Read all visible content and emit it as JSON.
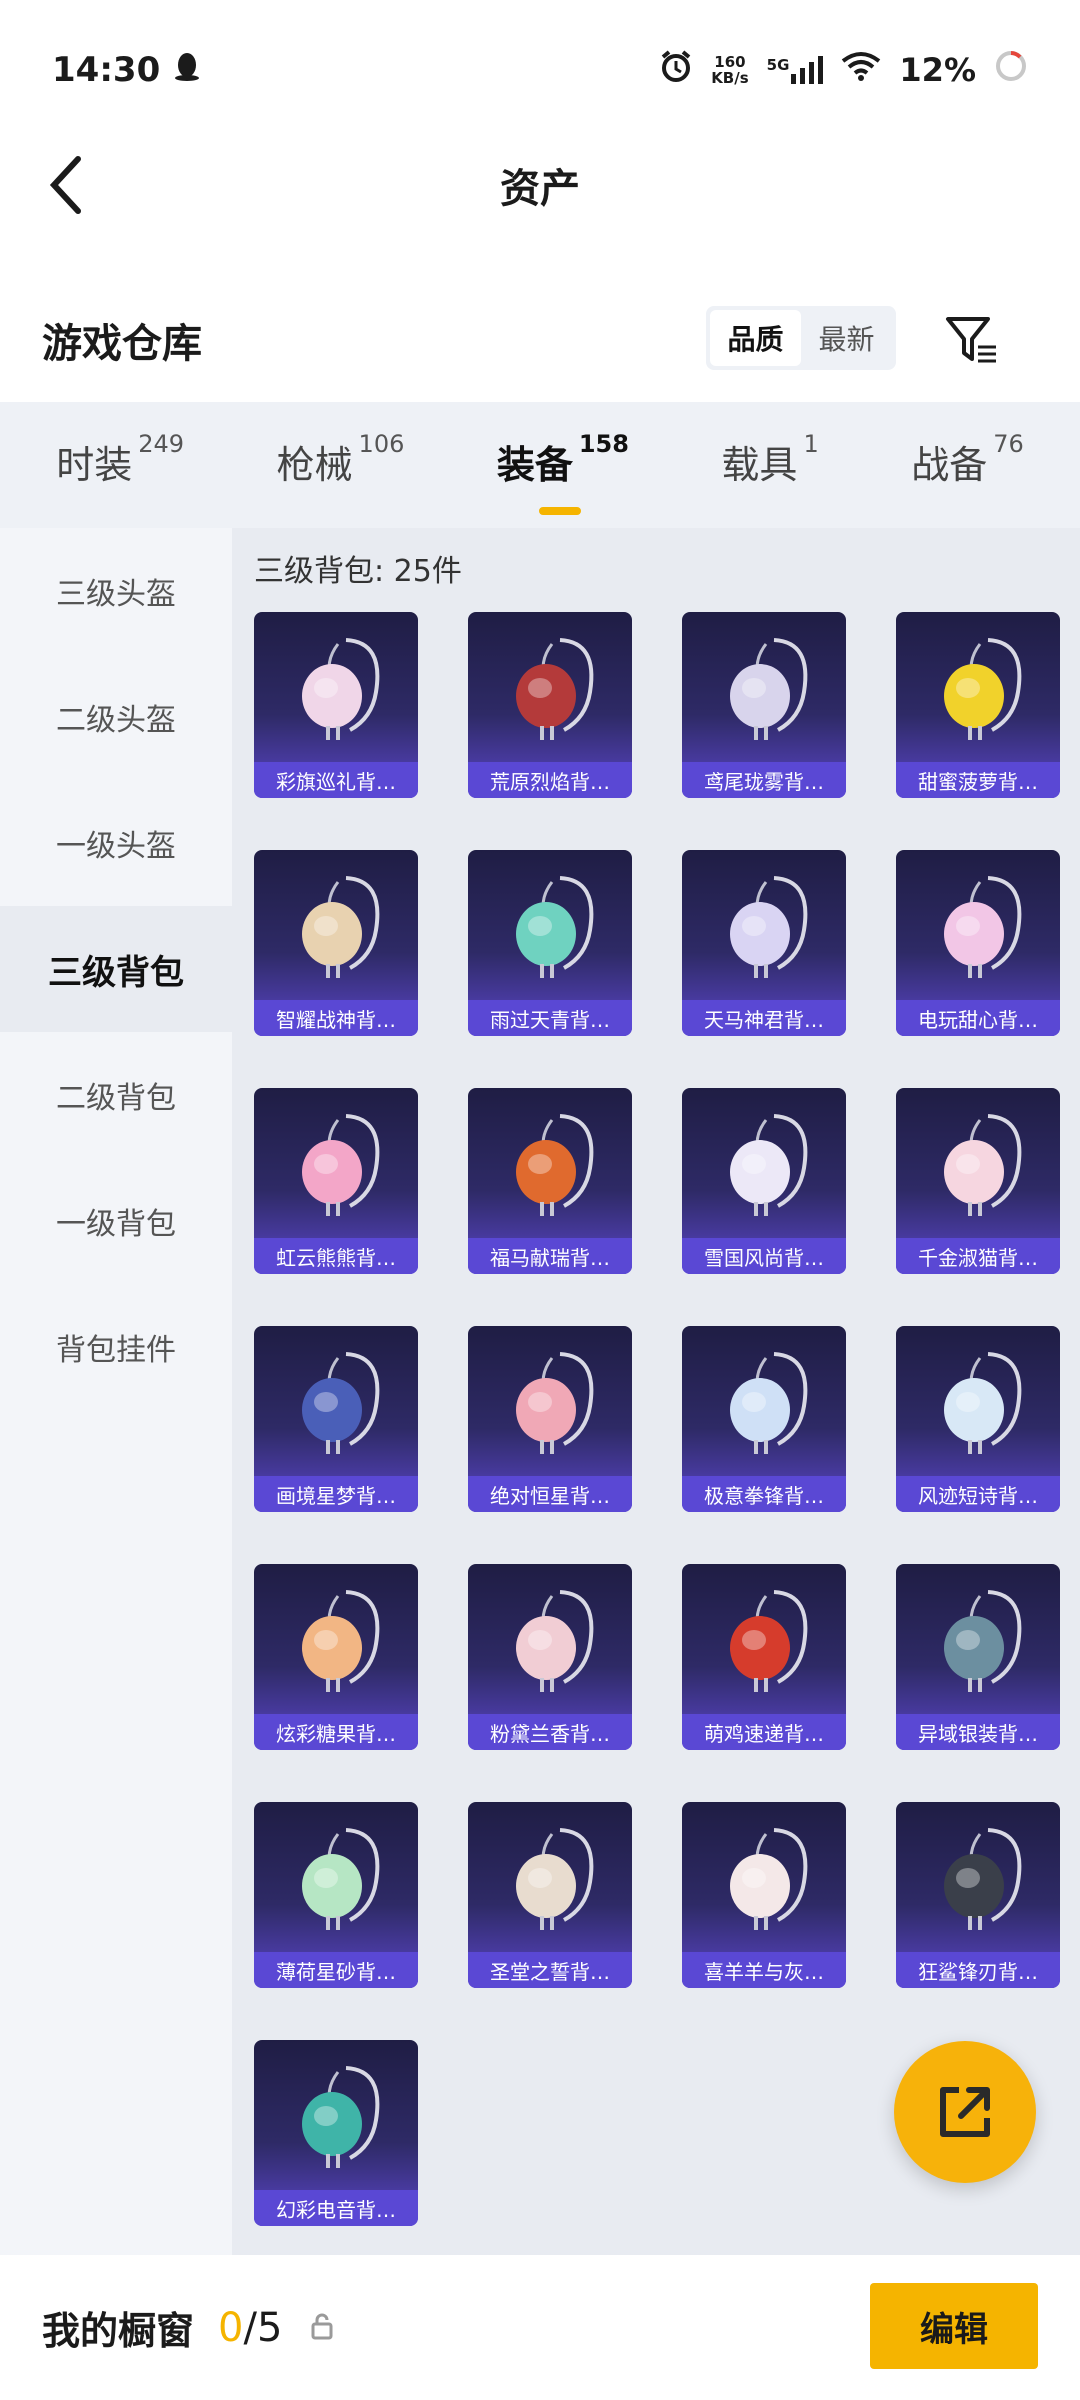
{
  "status_bar": {
    "time": "14:30",
    "net_speed_value": "160",
    "net_speed_unit": "KB/s",
    "network_type": "5G",
    "battery": "12%"
  },
  "header": {
    "title": "资产"
  },
  "warehouse": {
    "title": "游戏仓库",
    "sort_options": [
      "品质",
      "最新"
    ],
    "active_sort": "品质"
  },
  "tabs": [
    {
      "label": "时装",
      "count": "249"
    },
    {
      "label": "枪械",
      "count": "106"
    },
    {
      "label": "装备",
      "count": "158"
    },
    {
      "label": "载具",
      "count": "1"
    },
    {
      "label": "战备",
      "count": "76"
    }
  ],
  "active_tab": "装备",
  "sidebar": {
    "items": [
      "三级头盔",
      "二级头盔",
      "一级头盔",
      "三级背包",
      "二级背包",
      "一级背包",
      "背包挂件"
    ],
    "active": "三级背包"
  },
  "grid": {
    "title": "三级背包: 25件",
    "items": [
      {
        "name": "彩旗巡礼背…",
        "color": "#f0d6e8"
      },
      {
        "name": "荒原烈焰背…",
        "color": "#b43a3a"
      },
      {
        "name": "鸢尾珑雾背…",
        "color": "#d8d4ec"
      },
      {
        "name": "甜蜜菠萝背…",
        "color": "#f1d22b"
      },
      {
        "name": "智耀战神背…",
        "color": "#e8d2b0"
      },
      {
        "name": "雨过天青背…",
        "color": "#6fd2c0"
      },
      {
        "name": "天马神君背…",
        "color": "#d9d4f3"
      },
      {
        "name": "电玩甜心背…",
        "color": "#f2c6e6"
      },
      {
        "name": "虹云熊熊背…",
        "color": "#f3a6c8"
      },
      {
        "name": "福马献瑞背…",
        "color": "#e06a2e"
      },
      {
        "name": "雪国风尚背…",
        "color": "#ece8f7"
      },
      {
        "name": "千金淑猫背…",
        "color": "#f6d6e0"
      },
      {
        "name": "画境星梦背…",
        "color": "#4a5fb8"
      },
      {
        "name": "绝对恒星背…",
        "color": "#f0a8b6"
      },
      {
        "name": "极意拳锋背…",
        "color": "#cfe0f6"
      },
      {
        "name": "风迹短诗背…",
        "color": "#d8e8f6"
      },
      {
        "name": "炫彩糖果背…",
        "color": "#f2b684"
      },
      {
        "name": "粉黛兰香背…",
        "color": "#f1cdd4"
      },
      {
        "name": "萌鸡速递背…",
        "color": "#d63c2c"
      },
      {
        "name": "异域银装背…",
        "color": "#6c8fa0"
      },
      {
        "name": "薄荷星砂背…",
        "color": "#b6e6c4"
      },
      {
        "name": "圣堂之誓背…",
        "color": "#e8dccf"
      },
      {
        "name": "喜羊羊与灰…",
        "color": "#f4e8e8"
      },
      {
        "name": "狂鲨锋刃背…",
        "color": "#3a3f4a"
      },
      {
        "name": "幻彩电音背…",
        "color": "#3fb4a8"
      }
    ]
  },
  "bottom": {
    "title": "我的橱窗",
    "current": "0",
    "separator": "/",
    "total": "5",
    "edit_label": "编辑"
  },
  "colors": {
    "accent": "#f5b400",
    "card_label_bg": "#5a48d4"
  }
}
